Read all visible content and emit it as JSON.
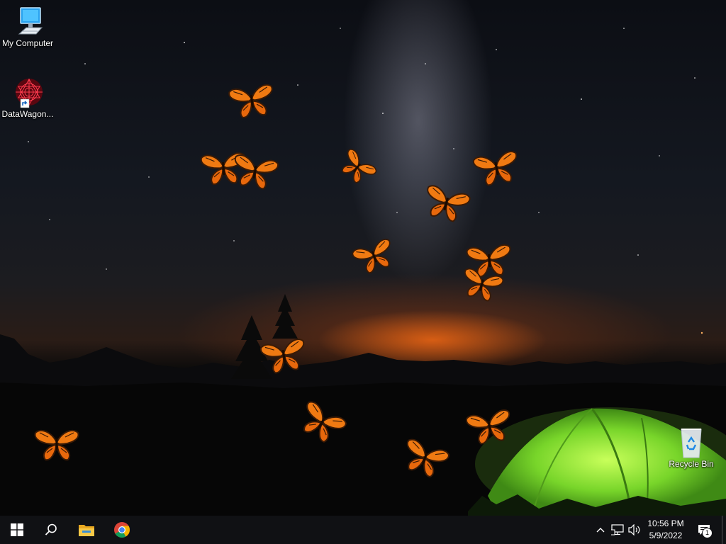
{
  "desktop": {
    "icons": [
      {
        "label": "My Computer",
        "icon": "computer-icon"
      },
      {
        "label": "DataWagon...",
        "icon": "datawagon-icon"
      },
      {
        "label": "Recycle Bin",
        "icon": "recycle-bin-icon"
      }
    ],
    "wallpaper": {
      "subject": "night sky camping with glowing green tent and monarch butterflies",
      "butterfly_count": 14
    }
  },
  "taskbar": {
    "start": {
      "icon": "windows-start-icon"
    },
    "search": {
      "icon": "search-icon"
    },
    "pinned": [
      {
        "icon": "file-explorer-icon"
      },
      {
        "icon": "chrome-icon"
      }
    ],
    "tray": {
      "icons": [
        "chevron-up-icon",
        "network-icon",
        "volume-icon"
      ],
      "time": "10:56 PM",
      "date": "5/9/2022",
      "notifications": "1"
    }
  },
  "colors": {
    "taskbar": "#101114",
    "tent": "#7fe02a",
    "butterfly": "#f07a12"
  }
}
